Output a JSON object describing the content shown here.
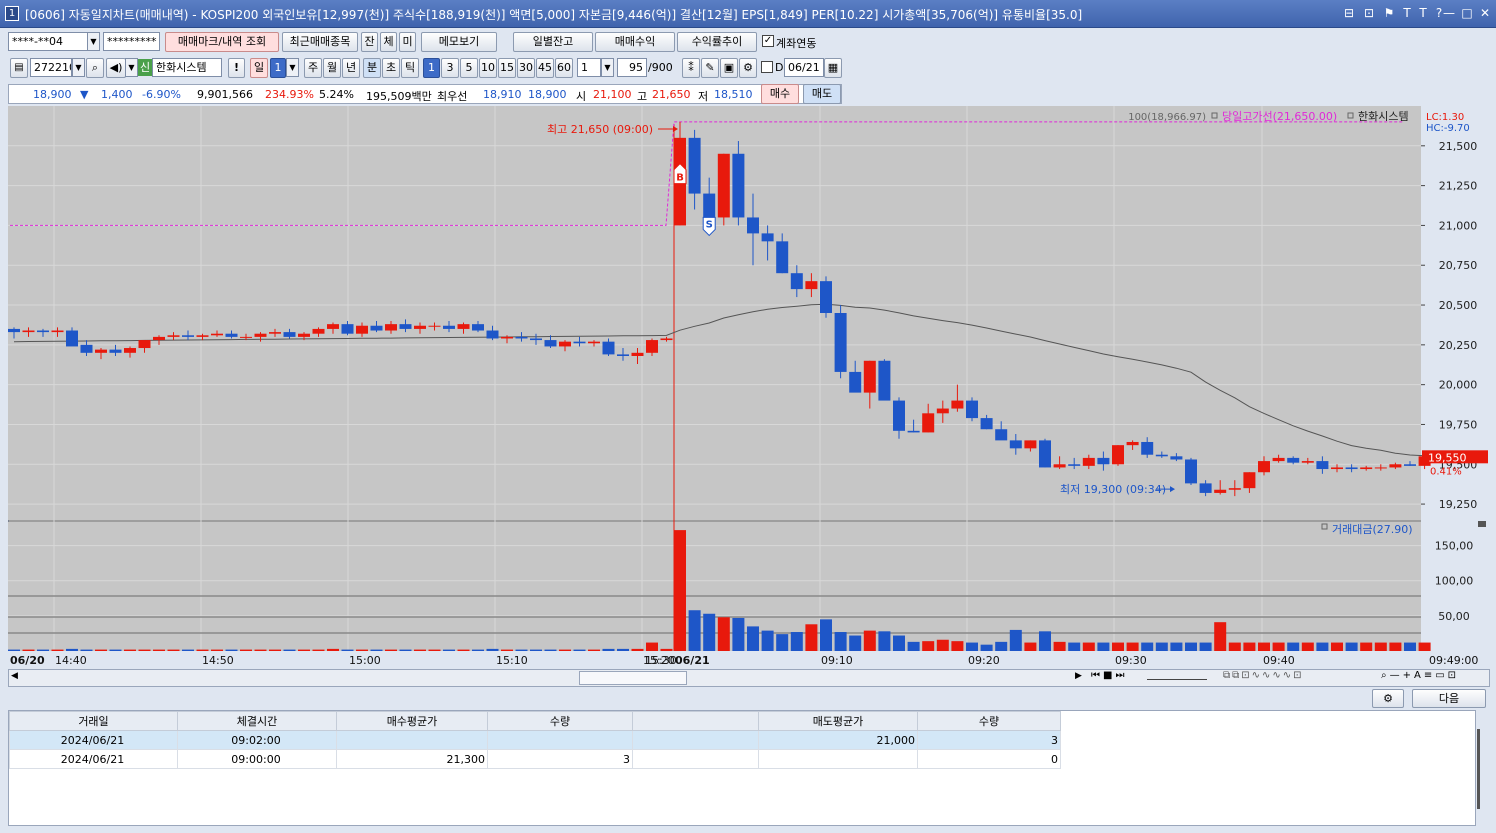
{
  "window": {
    "id": "1",
    "title": "[0606] 자동일지차트(매매내역) - KOSPI200 외국인보유[12,997(천)] 주식수[188,919(천)] 액면[5,000] 자본금[9,446(억)] 결산[12월] EPS[1,849] PER[10.22] 시가총액[35,706(억)] 유통비율[35.0]",
    "controls": [
      "⊟",
      "⊡",
      "⚑",
      "T",
      "T",
      "?",
      "—",
      "□",
      "✕"
    ]
  },
  "toolbar1": {
    "account": "****-**04",
    "password": "*********",
    "btn_trade_mark": "매매마크/내역 조회",
    "btn_recent": "최근매매종목",
    "btn_jan": "잔",
    "btn_che": "체",
    "btn_mi": "미",
    "btn_memo": "메모보기",
    "btn_daily_balance": "일별잔고",
    "btn_trade_profit": "매매수익",
    "btn_return_trend": "수익률추이",
    "link_account_label": "계좌연동",
    "link_account_checked": true
  },
  "toolbar2": {
    "code": "272210",
    "company_badge": "신",
    "company": "한화시스템",
    "period_day": "일",
    "period_day_count": "1",
    "periods": [
      "주",
      "월",
      "년",
      "분",
      "초",
      "틱"
    ],
    "minute_options": [
      "1",
      "3",
      "5",
      "10",
      "15",
      "30",
      "45",
      "60"
    ],
    "interval": "1",
    "count": "95",
    "count_max": "/900",
    "d_label": "D",
    "date": "06/21"
  },
  "quote": {
    "price": "18,900",
    "arrow": "▼",
    "change": "1,400",
    "change_pct": "-6.90%",
    "volume": "9,901,566",
    "vol_ratio": "234.93%",
    "turnover": "5.24%",
    "amount": "195,509백만",
    "best_label": "최우선",
    "ask": "18,910",
    "bid": "18,900",
    "open_label": "시",
    "open": "21,100",
    "high_label": "고",
    "high": "21,650",
    "low_label": "저",
    "low": "18,510",
    "buy": "매수",
    "sell": "매도"
  },
  "chart_data": {
    "type": "candlestick",
    "overlay": {
      "ma_label": "100(18,966.97)",
      "highline_label": "당일고가선(21,650.00)",
      "legend_name": "한화시스템",
      "lc": "LC:1.30",
      "hc": "HC:-9.70"
    },
    "annotations": {
      "high": "최고 21,650 (09:00)",
      "low": "최저 19,300 (09:34)",
      "buy_mark": "B",
      "sell_mark": "S"
    },
    "last_price": "19,550",
    "last_pct": "0.41%",
    "yticks": [
      "21,500",
      "21,250",
      "21,000",
      "20,750",
      "20,500",
      "20,250",
      "20,000",
      "19,750",
      "19,500",
      "19,250"
    ],
    "ylim": [
      19150,
      21750
    ],
    "vol_title": "거래대금(27.90)",
    "vol_yticks": [
      "150,00",
      "100,00",
      "50,00"
    ],
    "vol_ylim": [
      0,
      175
    ],
    "xlabels": [
      "06/20",
      "14:40",
      "14:50",
      "15:00",
      "15:10",
      "15:20",
      "15:30",
      "06/21",
      "09:10",
      "09:20",
      "09:30",
      "09:40",
      "09:49:00"
    ],
    "prev_day": [
      [
        20350,
        20360,
        20290,
        20330
      ],
      [
        20330,
        20360,
        20300,
        20340
      ],
      [
        20340,
        20350,
        20300,
        20330
      ],
      [
        20330,
        20360,
        20300,
        20340
      ],
      [
        20340,
        20360,
        20250,
        20240
      ],
      [
        20250,
        20280,
        20180,
        20200
      ],
      [
        20200,
        20230,
        20160,
        20220
      ],
      [
        20220,
        20250,
        20180,
        20200
      ],
      [
        20200,
        20240,
        20170,
        20230
      ],
      [
        20230,
        20260,
        20200,
        20280
      ],
      [
        20280,
        20310,
        20250,
        20300
      ],
      [
        20300,
        20330,
        20280,
        20310
      ],
      [
        20310,
        20340,
        20280,
        20300
      ],
      [
        20300,
        20320,
        20280,
        20310
      ],
      [
        20310,
        20340,
        20300,
        20320
      ],
      [
        20320,
        20340,
        20290,
        20300
      ],
      [
        20300,
        20320,
        20280,
        20300
      ],
      [
        20300,
        20330,
        20270,
        20320
      ],
      [
        20320,
        20350,
        20300,
        20330
      ],
      [
        20330,
        20350,
        20290,
        20300
      ],
      [
        20300,
        20330,
        20280,
        20320
      ],
      [
        20320,
        20360,
        20300,
        20350
      ],
      [
        20350,
        20390,
        20320,
        20380
      ],
      [
        20380,
        20400,
        20310,
        20320
      ],
      [
        20320,
        20390,
        20300,
        20370
      ],
      [
        20370,
        20400,
        20330,
        20340
      ],
      [
        20340,
        20400,
        20320,
        20380
      ],
      [
        20380,
        20410,
        20330,
        20350
      ],
      [
        20350,
        20390,
        20320,
        20370
      ],
      [
        20370,
        20390,
        20340,
        20370
      ],
      [
        20370,
        20400,
        20330,
        20350
      ],
      [
        20350,
        20390,
        20320,
        20380
      ],
      [
        20380,
        20400,
        20330,
        20340
      ],
      [
        20340,
        20370,
        20280,
        20290
      ],
      [
        20290,
        20310,
        20260,
        20300
      ],
      [
        20300,
        20330,
        20270,
        20290
      ],
      [
        20290,
        20320,
        20250,
        20280
      ],
      [
        20280,
        20310,
        20230,
        20240
      ],
      [
        20240,
        20280,
        20210,
        20270
      ],
      [
        20270,
        20300,
        20240,
        20260
      ],
      [
        20260,
        20280,
        20240,
        20270
      ],
      [
        20270,
        20290,
        20180,
        20190
      ],
      [
        20190,
        20230,
        20150,
        20180
      ],
      [
        20180,
        20230,
        20130,
        20200
      ],
      [
        20200,
        20290,
        20180,
        20280
      ],
      [
        20280,
        20300,
        20270,
        20290
      ]
    ],
    "today": [
      [
        21000,
        21650,
        21000,
        21550
      ],
      [
        21550,
        21600,
        21100,
        21200
      ],
      [
        21200,
        21300,
        20950,
        21050
      ],
      [
        21050,
        21450,
        21000,
        21450
      ],
      [
        21450,
        21530,
        21000,
        21050
      ],
      [
        21050,
        21200,
        20750,
        20950
      ],
      [
        20950,
        21000,
        20780,
        20900
      ],
      [
        20900,
        20950,
        20700,
        20700
      ],
      [
        20700,
        20750,
        20550,
        20600
      ],
      [
        20600,
        20700,
        20550,
        20650
      ],
      [
        20650,
        20680,
        20420,
        20450
      ],
      [
        20450,
        20500,
        20040,
        20080
      ],
      [
        20080,
        20150,
        19980,
        19950
      ],
      [
        19950,
        20150,
        19850,
        20150
      ],
      [
        20150,
        20160,
        19910,
        19900
      ],
      [
        19900,
        19920,
        19660,
        19710
      ],
      [
        19710,
        19780,
        19700,
        19700
      ],
      [
        19700,
        19880,
        19700,
        19820
      ],
      [
        19820,
        19900,
        19760,
        19850
      ],
      [
        19850,
        20000,
        19830,
        19900
      ],
      [
        19900,
        19920,
        19770,
        19790
      ],
      [
        19790,
        19810,
        19720,
        19720
      ],
      [
        19720,
        19770,
        19680,
        19650
      ],
      [
        19650,
        19690,
        19560,
        19600
      ],
      [
        19600,
        19650,
        19580,
        19650
      ],
      [
        19650,
        19660,
        19480,
        19480
      ],
      [
        19480,
        19550,
        19470,
        19500
      ],
      [
        19500,
        19540,
        19470,
        19490
      ],
      [
        19490,
        19560,
        19470,
        19540
      ],
      [
        19540,
        19580,
        19460,
        19500
      ],
      [
        19500,
        19620,
        19490,
        19620
      ],
      [
        19620,
        19650,
        19590,
        19640
      ],
      [
        19640,
        19670,
        19540,
        19560
      ],
      [
        19560,
        19580,
        19540,
        19550
      ],
      [
        19550,
        19570,
        19520,
        19530
      ],
      [
        19530,
        19540,
        19370,
        19380
      ],
      [
        19380,
        19400,
        19300,
        19320
      ],
      [
        19320,
        19400,
        19310,
        19340
      ],
      [
        19340,
        19400,
        19300,
        19350
      ],
      [
        19350,
        19450,
        19320,
        19450
      ],
      [
        19450,
        19550,
        19430,
        19520
      ],
      [
        19520,
        19560,
        19510,
        19540
      ],
      [
        19540,
        19550,
        19500,
        19510
      ],
      [
        19510,
        19540,
        19500,
        19520
      ],
      [
        19520,
        19550,
        19440,
        19470
      ],
      [
        19470,
        19500,
        19450,
        19480
      ],
      [
        19480,
        19500,
        19450,
        19470
      ],
      [
        19470,
        19490,
        19460,
        19480
      ],
      [
        19480,
        19500,
        19460,
        19480
      ],
      [
        19480,
        19510,
        19470,
        19500
      ],
      [
        19500,
        19520,
        19490,
        19490
      ],
      [
        19490,
        19550,
        19470,
        19550
      ]
    ],
    "prev_vol": [
      2,
      2,
      2,
      2,
      3,
      2,
      2,
      2,
      2,
      2,
      2,
      2,
      2,
      2,
      2,
      2,
      2,
      2,
      2,
      2,
      2,
      2,
      3,
      2,
      2,
      2,
      2,
      2,
      2,
      2,
      2,
      2,
      2,
      3,
      2,
      2,
      2,
      2,
      2,
      2,
      2,
      3,
      3,
      3,
      12,
      3
    ],
    "today_vol": [
      172,
      58,
      53,
      48,
      47,
      35,
      29,
      24,
      27,
      38,
      45,
      27,
      22,
      29,
      28,
      22,
      13,
      14,
      16,
      14,
      12,
      9,
      13,
      30,
      12,
      28,
      13,
      12,
      12,
      12,
      12,
      12,
      12,
      12,
      12,
      12,
      12,
      41,
      12,
      12,
      12,
      12,
      12,
      12,
      12,
      12,
      12,
      12,
      12,
      12,
      12,
      12
    ]
  },
  "bottom": {
    "next_button": "다음",
    "headers": [
      "거래일",
      "체결시간",
      "매수평균가",
      "수량",
      "",
      "매도평균가",
      "수량"
    ],
    "rows": [
      [
        "2024/06/21",
        "09:02:00",
        "",
        "",
        "",
        "21,000",
        "3"
      ],
      [
        "2024/06/21",
        "09:00:00",
        "21,300",
        "3",
        "",
        "",
        "0"
      ]
    ]
  },
  "colors": {
    "up": "#e8190c",
    "down": "#1e56c8",
    "ma": "#555555",
    "highline": "#e029d8"
  }
}
